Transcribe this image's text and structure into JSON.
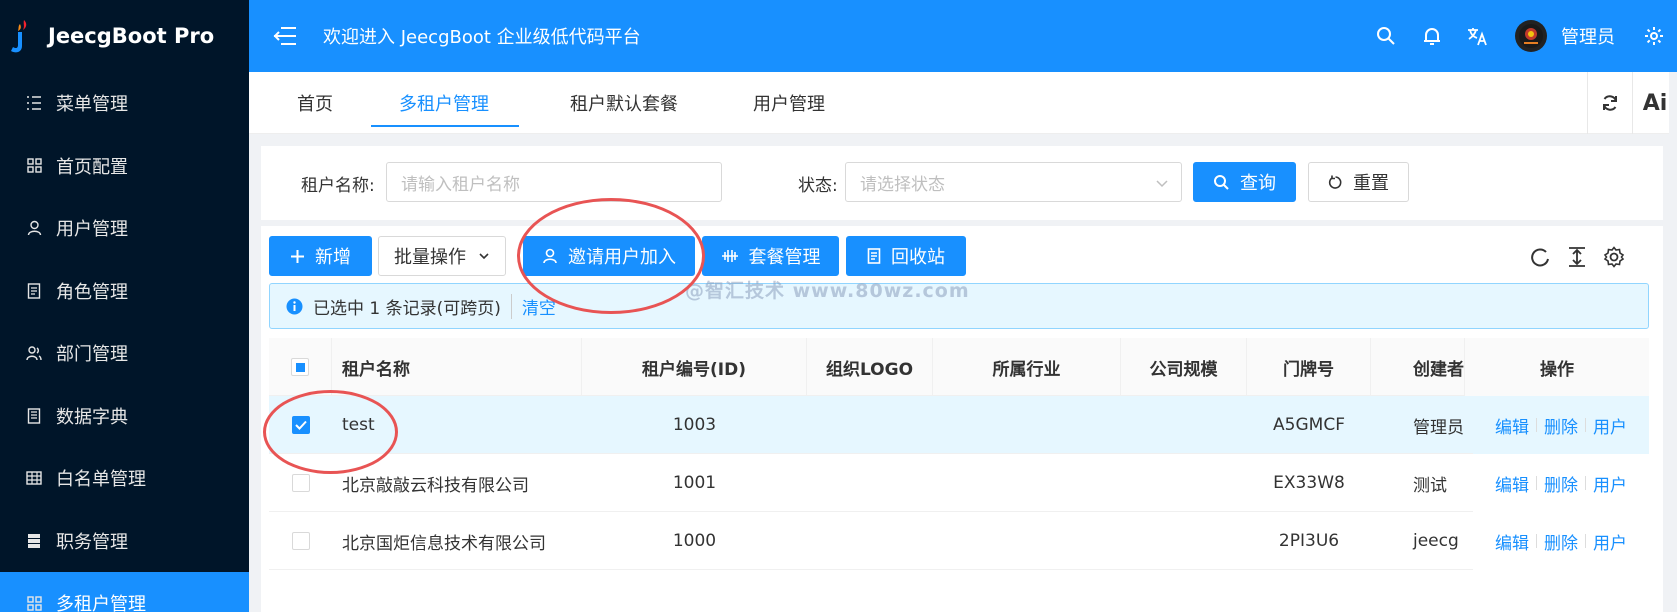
{
  "app": {
    "name": "JeecgBoot Pro",
    "welcome": "欢迎进入 JeecgBoot 企业级低代码平台"
  },
  "header": {
    "user_name": "管理员",
    "icons": [
      "search-icon",
      "bell-icon",
      "translate-icon",
      "avatar",
      "gear-icon"
    ]
  },
  "sidebar": {
    "items": [
      {
        "label": "菜单管理",
        "icon": "menu-list-icon"
      },
      {
        "label": "首页配置",
        "icon": "grid-icon"
      },
      {
        "label": "用户管理",
        "icon": "user-icon"
      },
      {
        "label": "角色管理",
        "icon": "role-icon"
      },
      {
        "label": "部门管理",
        "icon": "team-icon"
      },
      {
        "label": "数据字典",
        "icon": "dictionary-icon"
      },
      {
        "label": "白名单管理",
        "icon": "table-icon"
      },
      {
        "label": "职务管理",
        "icon": "server-icon"
      },
      {
        "label": "多租户管理",
        "icon": "grid-icon",
        "active": true
      }
    ]
  },
  "tabs": [
    {
      "label": "首页"
    },
    {
      "label": "多租户管理",
      "active": true
    },
    {
      "label": "租户默认套餐"
    },
    {
      "label": "用户管理"
    }
  ],
  "tab_tools": {
    "ai_label": "Ai"
  },
  "search": {
    "tenant_name_label": "租户名称:",
    "tenant_name_placeholder": "请输入租户名称",
    "status_label": "状态:",
    "status_placeholder": "请选择状态",
    "query_label": "查询",
    "reset_label": "重置"
  },
  "toolbar": {
    "add_label": "新增",
    "batch_label": "批量操作",
    "invite_label": "邀请用户加入",
    "package_label": "套餐管理",
    "recycle_label": "回收站"
  },
  "alert": {
    "text": "已选中 1 条记录(可跨页)",
    "clear_label": "清空"
  },
  "watermark": "@智汇技术 www.80wz.com",
  "table": {
    "columns": [
      "租户名称",
      "租户编号(ID)",
      "组织LOGO",
      "所属行业",
      "公司规模",
      "门牌号",
      "创建者",
      "操作"
    ],
    "rows": [
      {
        "name": "test",
        "id": "1003",
        "logo": "",
        "industry": "",
        "size": "",
        "house_no": "A5GMCF",
        "creator": "管理员",
        "checked": true
      },
      {
        "name": "北京敲敲云科技有限公司",
        "id": "1001",
        "logo": "",
        "industry": "",
        "size": "",
        "house_no": "EX33W8",
        "creator": "测试",
        "checked": false
      },
      {
        "name": "北京国炬信息技术有限公司",
        "id": "1000",
        "logo": "",
        "industry": "",
        "size": "",
        "house_no": "2PI3U6",
        "creator": "jeecg",
        "checked": false
      }
    ],
    "actions": {
      "edit": "编辑",
      "delete": "删除",
      "user": "用户"
    }
  },
  "colors": {
    "primary": "#1890ff",
    "sidebar_bg": "#001529",
    "annotation": "#e85454"
  }
}
